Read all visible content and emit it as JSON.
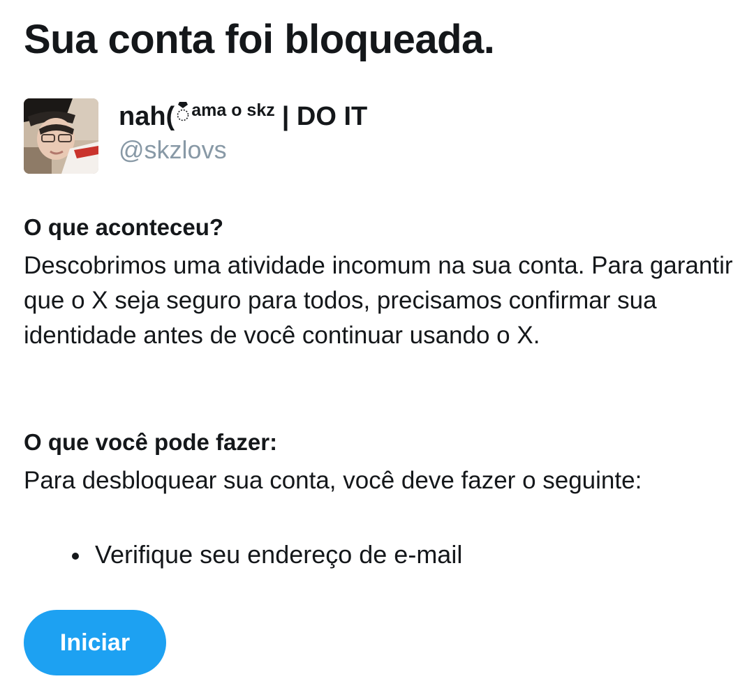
{
  "page_title": "Sua conta foi bloqueada.",
  "profile": {
    "display_name_prefix": "nah(",
    "display_name_icon": "ring-icon",
    "display_name_super": "ama o skz",
    "display_name_suffix": "| DO IT",
    "handle": "@skzlovs"
  },
  "what_happened": {
    "heading": "O que aconteceu?",
    "body": "Descobrimos uma atividade incomum na sua conta. Para garantir que o X seja seguro para todos, precisamos confirmar sua identidade antes de você continuar usando o X."
  },
  "what_to_do": {
    "heading": "O que você pode fazer:",
    "body": "Para desbloquear sua conta, você deve fazer o seguinte:",
    "steps": [
      "Verifique seu endereço de e-mail"
    ]
  },
  "start_button": {
    "label": "Iniciar"
  },
  "colors": {
    "accent": "#1da1f2",
    "text": "#14171a",
    "muted": "#8899a6",
    "background": "#ffffff"
  }
}
